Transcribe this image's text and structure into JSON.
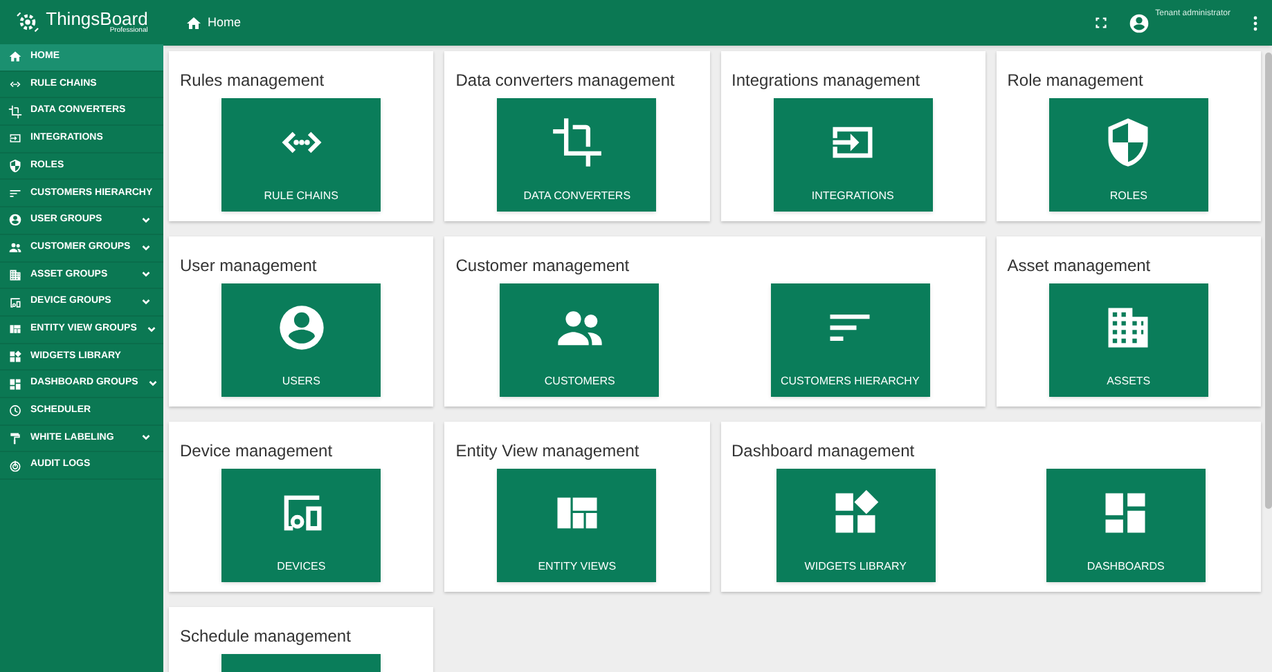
{
  "logo": {
    "name": "ThingsBoard",
    "edition": "Professional"
  },
  "sidebar": {
    "items": [
      {
        "label": "HOME",
        "selected": true,
        "expandable": false
      },
      {
        "label": "RULE CHAINS",
        "selected": false,
        "expandable": false
      },
      {
        "label": "DATA CONVERTERS",
        "selected": false,
        "expandable": false
      },
      {
        "label": "INTEGRATIONS",
        "selected": false,
        "expandable": false
      },
      {
        "label": "ROLES",
        "selected": false,
        "expandable": false
      },
      {
        "label": "CUSTOMERS HIERARCHY",
        "selected": false,
        "expandable": false
      },
      {
        "label": "USER GROUPS",
        "selected": false,
        "expandable": true
      },
      {
        "label": "CUSTOMER GROUPS",
        "selected": false,
        "expandable": true
      },
      {
        "label": "ASSET GROUPS",
        "selected": false,
        "expandable": true
      },
      {
        "label": "DEVICE GROUPS",
        "selected": false,
        "expandable": true
      },
      {
        "label": "ENTITY VIEW GROUPS",
        "selected": false,
        "expandable": true
      },
      {
        "label": "WIDGETS LIBRARY",
        "selected": false,
        "expandable": false
      },
      {
        "label": "DASHBOARD GROUPS",
        "selected": false,
        "expandable": true
      },
      {
        "label": "SCHEDULER",
        "selected": false,
        "expandable": false
      },
      {
        "label": "WHITE LABELING",
        "selected": false,
        "expandable": true
      },
      {
        "label": "AUDIT LOGS",
        "selected": false,
        "expandable": false
      }
    ]
  },
  "topbar": {
    "breadcrumb": "Home",
    "user_role": "Tenant administrator"
  },
  "cards": [
    {
      "title": "Rules management",
      "tiles": [
        "RULE CHAINS"
      ]
    },
    {
      "title": "Data converters management",
      "tiles": [
        "DATA CONVERTERS"
      ]
    },
    {
      "title": "Integrations management",
      "tiles": [
        "INTEGRATIONS"
      ]
    },
    {
      "title": "Role management",
      "tiles": [
        "ROLES"
      ]
    },
    {
      "title": "User management",
      "tiles": [
        "USERS"
      ]
    },
    {
      "title": "Customer management",
      "tiles": [
        "CUSTOMERS",
        "CUSTOMERS HIERARCHY"
      ]
    },
    {
      "title": "Asset management",
      "tiles": [
        "ASSETS"
      ]
    },
    {
      "title": "Device management",
      "tiles": [
        "DEVICES"
      ]
    },
    {
      "title": "Entity View management",
      "tiles": [
        "ENTITY VIEWS"
      ]
    },
    {
      "title": "Dashboard management",
      "tiles": [
        "WIDGETS LIBRARY",
        "DASHBOARDS"
      ]
    },
    {
      "title": "Schedule management",
      "cut_off_tile": true
    }
  ]
}
